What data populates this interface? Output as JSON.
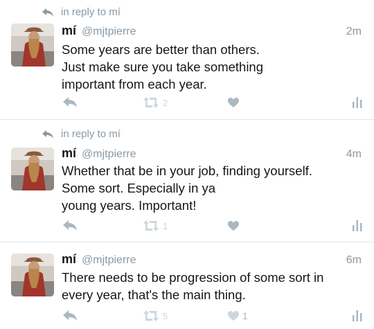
{
  "tweets": [
    {
      "reply_context": "in reply to mí",
      "name": "mí",
      "handle": "@mjtpierre",
      "time": "2m",
      "lines": [
        "Some years are better than others.",
        "Just make sure you take something",
        "important from each year."
      ],
      "retweets": "2",
      "likes": ""
    },
    {
      "reply_context": "in reply to mí",
      "name": "mí",
      "handle": "@mjtpierre",
      "time": "4m",
      "lines": [
        "Whether that be in your job, finding yourself.",
        "Some sort. Especially in ya",
        "young years. Important!"
      ],
      "retweets": "1",
      "likes": ""
    },
    {
      "reply_context": "",
      "name": "mí",
      "handle": "@mjtpierre",
      "time": "6m",
      "lines": [
        "There needs to be progression of some sort in",
        "every year, that's the main thing."
      ],
      "retweets": "5",
      "likes": "1"
    }
  ],
  "icons": {
    "reply": "reply-icon",
    "retweet": "retweet-icon",
    "like": "heart-icon",
    "analytics": "analytics-icon",
    "reply_context": "reply-arrow-icon"
  },
  "colors": {
    "secondary_text": "#8899a6",
    "action_icon": "#aab8c2",
    "action_icon_light": "#ccd6dd",
    "divider": "#e1e8ed"
  }
}
